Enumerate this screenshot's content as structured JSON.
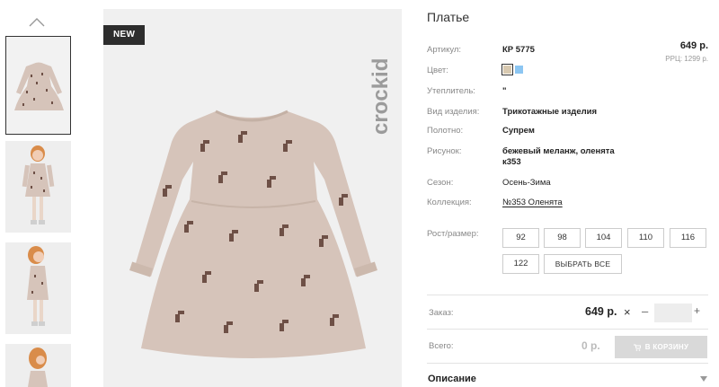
{
  "gallery": {
    "thumbnails": [
      {
        "type": "flat-lay",
        "selected": true
      },
      {
        "type": "model-front",
        "selected": false
      },
      {
        "type": "model-side",
        "selected": false
      },
      {
        "type": "model-back",
        "selected": false
      }
    ],
    "badge": "NEW",
    "logo_text": "crockid",
    "icons": {
      "up": "chevron-up-icon"
    }
  },
  "product": {
    "title": "Платье",
    "price": "649 р.",
    "rrp": "РРЦ: 1299 р."
  },
  "attributes": {
    "article": {
      "label": "Артикул:",
      "value": "КР 5775"
    },
    "color": {
      "label": "Цвет:",
      "swatches": [
        "#d8c9b0",
        "#8cc6f2"
      ]
    },
    "insulation": {
      "label": "Утеплитель:",
      "value": "\""
    },
    "product_type": {
      "label": "Вид изделия:",
      "value": "Трикотажные изделия"
    },
    "fabric": {
      "label": "Полотно:",
      "value": "Супрем"
    },
    "pattern": {
      "label": "Рисунок:",
      "value_line1": "бежевый меланж, оленята",
      "value_line2": "к353"
    },
    "season": {
      "label": "Сезон:",
      "value": "Осень-Зима"
    },
    "collection": {
      "label": "Коллекция:",
      "value": "№353 Оленята"
    }
  },
  "sizes": {
    "label": "Рост/размер:",
    "options": [
      "92",
      "98",
      "104",
      "110",
      "116",
      "122"
    ],
    "select_all": "ВЫБРАТЬ ВСЕ"
  },
  "order": {
    "label": "Заказ:",
    "price": "649 р.",
    "times": "×",
    "minus": "–",
    "plus": "+",
    "quantity": ""
  },
  "total": {
    "label": "Всего:",
    "value": "0 р.",
    "cart_button": "В КОРЗИНУ"
  },
  "description": {
    "title": "Описание"
  },
  "colors": {
    "accent_dark": "#2d2d2d",
    "disabled_button": "#d9d9d9",
    "dress": "#d6c4ba",
    "deer": "#6e5046"
  }
}
